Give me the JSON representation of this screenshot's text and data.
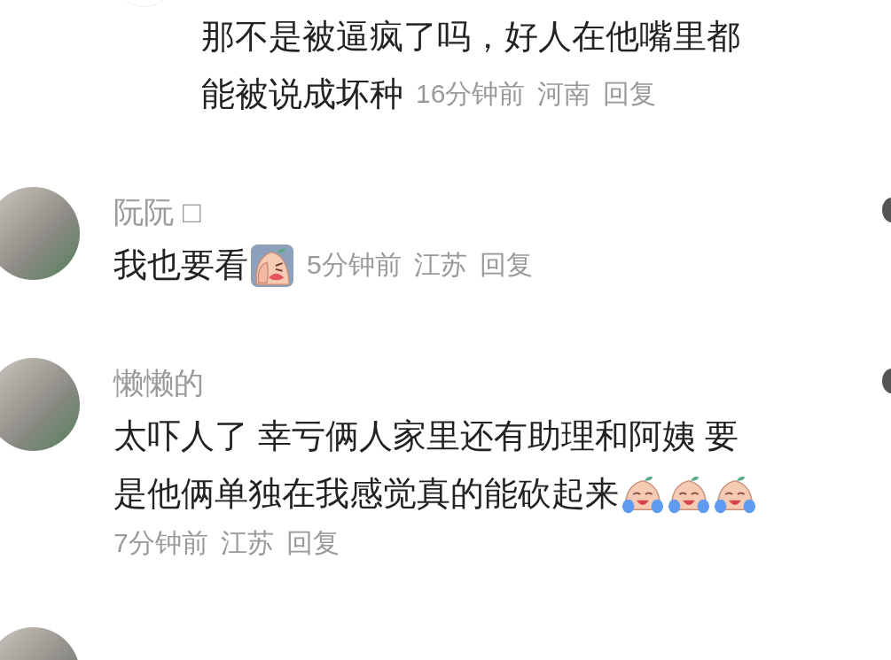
{
  "comments": [
    {
      "kind": "reply",
      "lines": [
        [
          {
            "kind": "text",
            "text": "那不是被逼疯了吗，好人在他嘴里都"
          }
        ],
        [
          {
            "kind": "text",
            "text": "能被说成坏种"
          }
        ]
      ],
      "meta_on_new_line": false,
      "time": "16分钟前",
      "location": "河南",
      "reply": "回复",
      "like_visible": false
    },
    {
      "kind": "top",
      "name": "阮阮",
      "name_suffix": "□",
      "lines": [
        [
          {
            "kind": "text",
            "text": "我也要看"
          },
          {
            "kind": "facepalm"
          }
        ]
      ],
      "meta_on_new_line": false,
      "time": "5分钟前",
      "location": "江苏",
      "reply": "回复",
      "like_visible": true
    },
    {
      "kind": "top",
      "name": "懒懒的",
      "lines": [
        [
          {
            "kind": "text",
            "text": "太吓人了 幸亏俩人家里还有助理和阿姨 要"
          }
        ],
        [
          {
            "kind": "text",
            "text": "是他俩单独在我感觉真的能砍起来"
          },
          {
            "kind": "laugh-cry"
          },
          {
            "kind": "laugh-cry"
          },
          {
            "kind": "laugh-cry"
          }
        ]
      ],
      "meta_on_new_line": true,
      "time": "7分钟前",
      "location": "江苏",
      "reply": "回复",
      "like_visible": true
    },
    {
      "kind": "partial"
    }
  ]
}
